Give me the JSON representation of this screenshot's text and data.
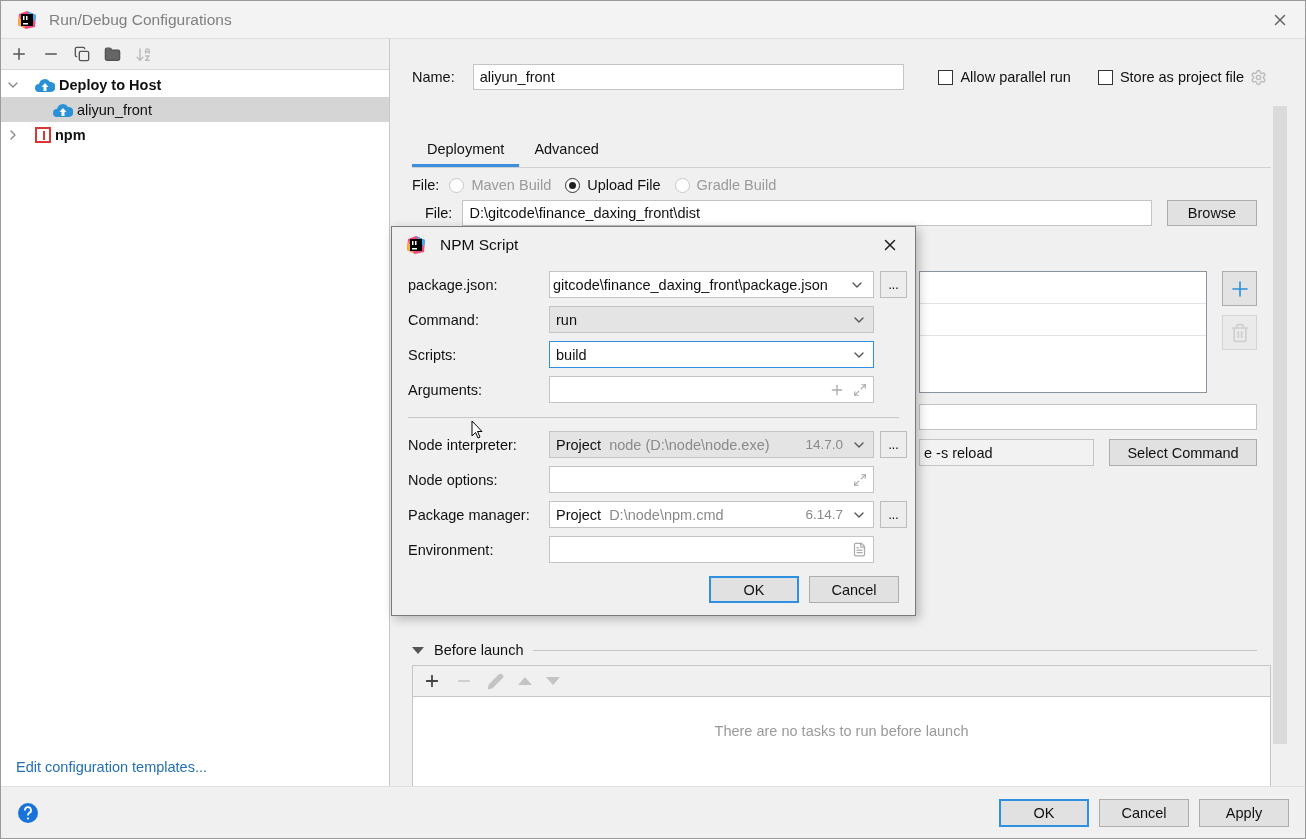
{
  "window": {
    "title": "Run/Debug Configurations"
  },
  "sidebar": {
    "tree": [
      {
        "label": "Deploy to Host",
        "kind": "deploy",
        "expanded": true,
        "selected": false,
        "children": [
          {
            "label": "aliyun_front",
            "kind": "deploy",
            "selected": true
          }
        ]
      },
      {
        "label": "npm",
        "kind": "npm",
        "expanded": false,
        "selected": false
      }
    ],
    "link": "Edit configuration templates..."
  },
  "config": {
    "name_label": "Name:",
    "name": "aliyun_front",
    "options": [
      {
        "label": "Allow parallel run",
        "checked": false
      },
      {
        "label": "Store as project file",
        "checked": false
      }
    ],
    "tabs": [
      {
        "label": "Deployment",
        "selected": true
      },
      {
        "label": "Advanced",
        "selected": false
      }
    ],
    "file_type": {
      "label": "File:",
      "options": [
        {
          "label": "Maven Build",
          "selected": false,
          "disabled": true
        },
        {
          "label": "Upload File",
          "selected": true,
          "disabled": false
        },
        {
          "label": "Gradle Build",
          "selected": false,
          "disabled": true
        }
      ]
    },
    "file": {
      "label": "File:",
      "value": "D:\\gitcode\\finance_daxing_front\\dist",
      "button": "Browse"
    },
    "command": {
      "value": "e -s reload",
      "button": "Select Command"
    },
    "before_launch": {
      "title": "Before launch",
      "expanded": true,
      "empty_text": "There are no tasks to run before launch"
    }
  },
  "dialog": {
    "title": "NPM Script",
    "sections": [
      [
        {
          "label": "package.json:",
          "kind": "combo",
          "value": "gitcode\\finance_daxing_front\\package.json",
          "focused": false,
          "browse": true
        },
        {
          "label": "Command:",
          "kind": "select",
          "value": "run",
          "focused": false,
          "browse": false
        },
        {
          "label": "Scripts:",
          "kind": "combo",
          "value": "build",
          "focused": true,
          "browse": false
        },
        {
          "label": "Arguments:",
          "kind": "args",
          "focused": false,
          "browse": false
        }
      ],
      [
        {
          "label": "Node interpreter:",
          "kind": "sdk-select",
          "value": "Project",
          "detail": "node (D:\\node\\node.exe)",
          "version": "14.7.0",
          "focused": false,
          "browse": true
        },
        {
          "label": "Node options:",
          "kind": "expand",
          "focused": false,
          "browse": false
        },
        {
          "label": "Package manager:",
          "kind": "sdk-combo",
          "value": "Project",
          "detail": "D:\\node\\npm.cmd",
          "version": "6.14.7",
          "focused": false,
          "browse": true
        },
        {
          "label": "Environment:",
          "kind": "env",
          "focused": false,
          "browse": false
        }
      ]
    ],
    "browse_label": "...",
    "buttons": [
      {
        "label": "OK",
        "default": true
      },
      {
        "label": "Cancel",
        "default": false
      }
    ]
  },
  "footer": {
    "buttons": [
      {
        "label": "OK",
        "default": true
      },
      {
        "label": "Cancel",
        "default": false
      },
      {
        "label": "Apply",
        "default": false
      }
    ]
  }
}
